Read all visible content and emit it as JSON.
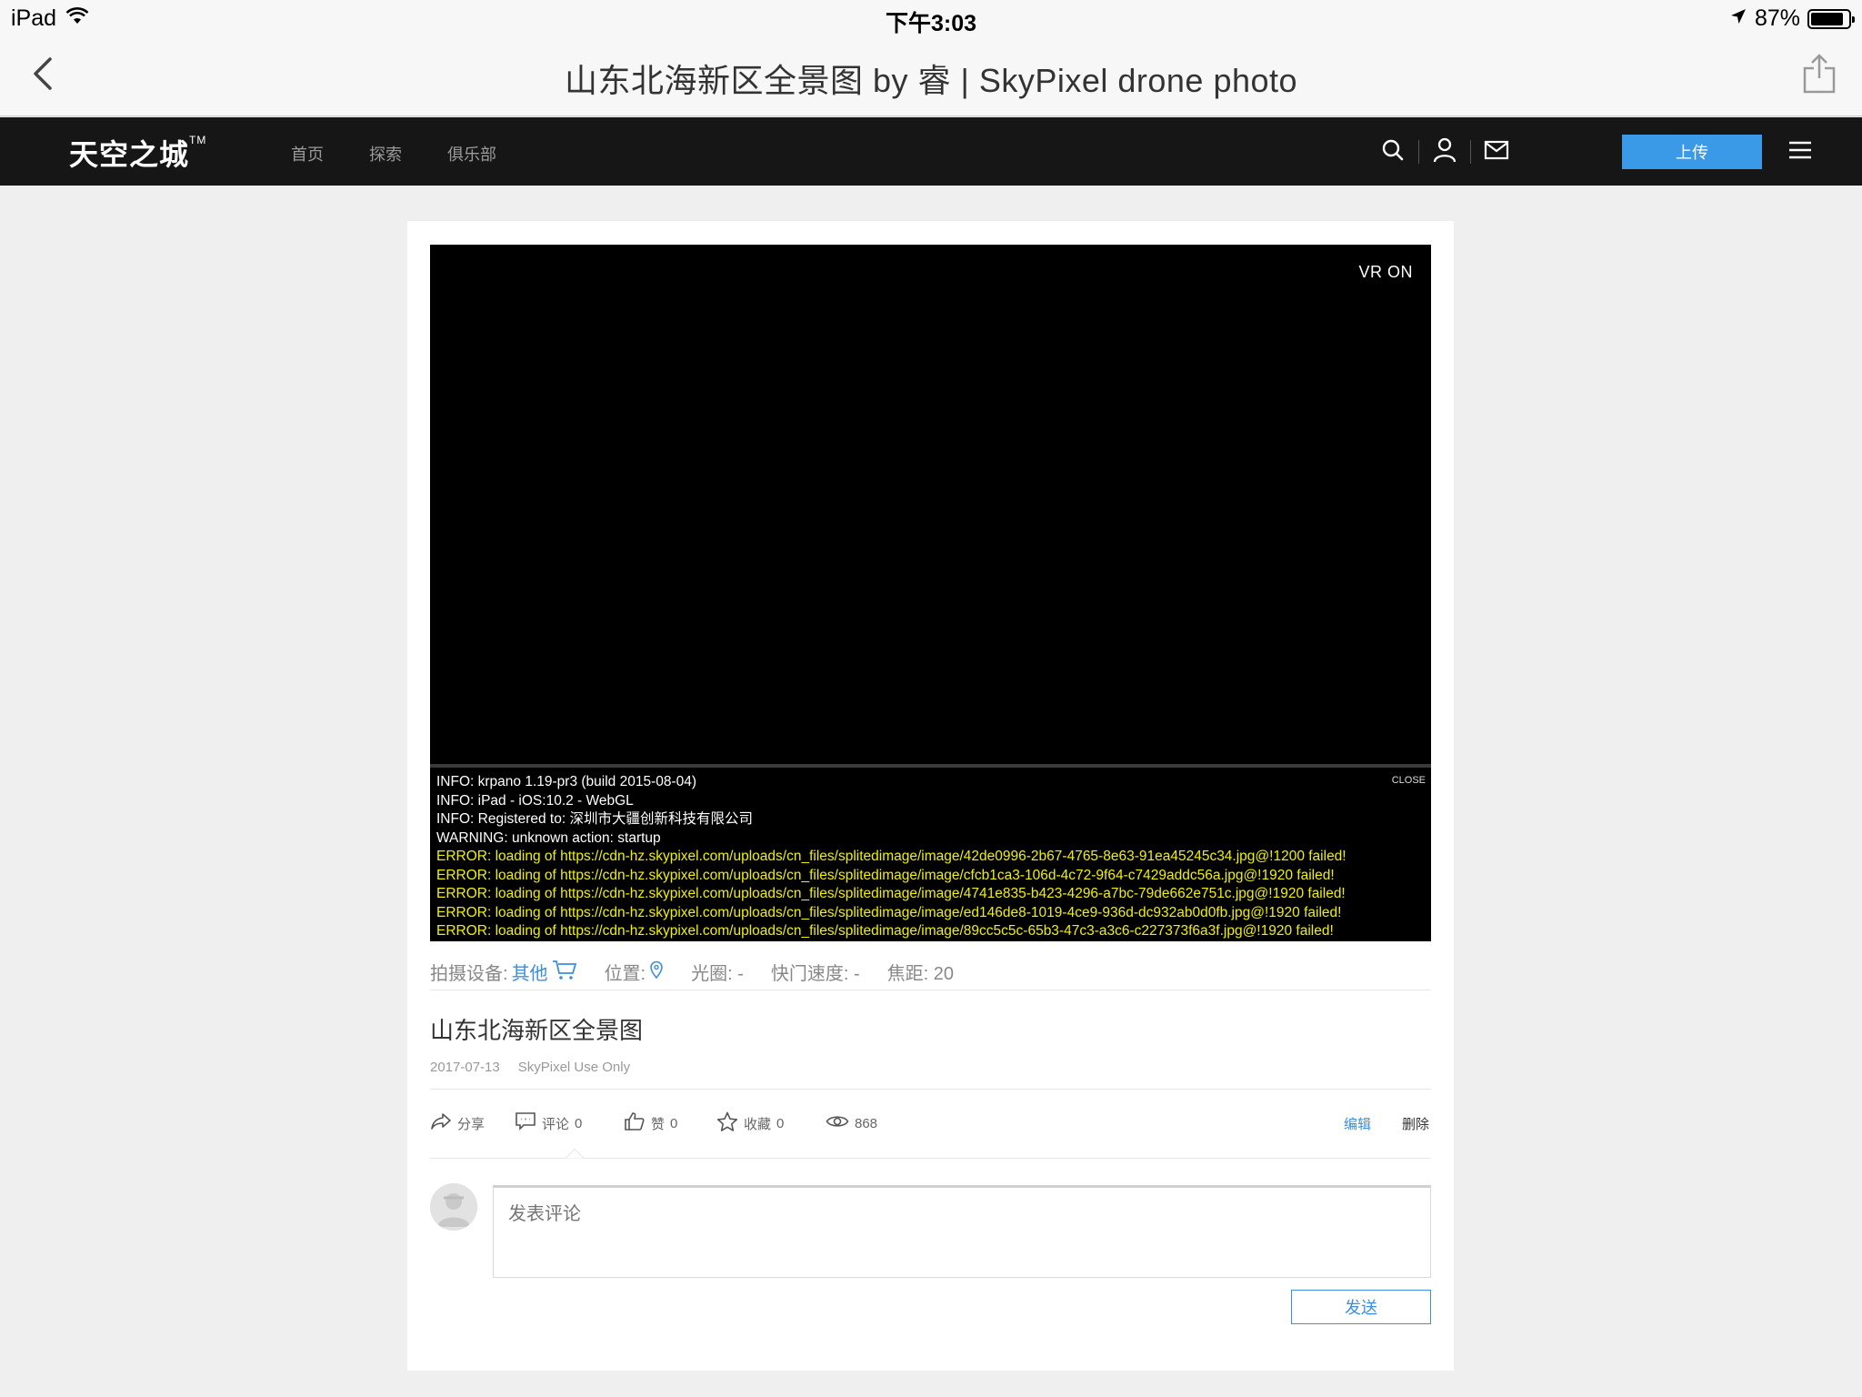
{
  "status_bar": {
    "device": "iPad",
    "time": "下午3:03",
    "battery_text": "87%",
    "battery_level": 0.87
  },
  "browser": {
    "page_title": "山东北海新区全景图 by 睿 | SkyPixel drone photo"
  },
  "site": {
    "logo": "天空之城",
    "logo_tm": "TM",
    "nav": [
      "首页",
      "探索",
      "俱乐部"
    ],
    "upload_label": "上传"
  },
  "viewer": {
    "vr_label": "VR ON",
    "console_close": "CLOSE",
    "log": [
      {
        "level": "info",
        "text": "INFO: krpano 1.19-pr3 (build 2015-08-04)"
      },
      {
        "level": "info",
        "text": "INFO: iPad - iOS:10.2 - WebGL"
      },
      {
        "level": "info",
        "text": "INFO: Registered to: 深圳市大疆创新科技有限公司"
      },
      {
        "level": "info",
        "text": "WARNING: unknown action: startup"
      },
      {
        "level": "error",
        "text": "ERROR: loading of https://cdn-hz.skypixel.com/uploads/cn_files/splitedimage/image/42de0996-2b67-4765-8e63-91ea45245c34.jpg@!1200 failed!"
      },
      {
        "level": "error",
        "text": "ERROR: loading of https://cdn-hz.skypixel.com/uploads/cn_files/splitedimage/image/cfcb1ca3-106d-4c72-9f64-c7429addc56a.jpg@!1920 failed!"
      },
      {
        "level": "error",
        "text": "ERROR: loading of https://cdn-hz.skypixel.com/uploads/cn_files/splitedimage/image/4741e835-b423-4296-a7bc-79de662e751c.jpg@!1920 failed!"
      },
      {
        "level": "error",
        "text": "ERROR: loading of https://cdn-hz.skypixel.com/uploads/cn_files/splitedimage/image/ed146de8-1019-4ce9-936d-dc932ab0d0fb.jpg@!1920 failed!"
      },
      {
        "level": "error",
        "text": "ERROR: loading of https://cdn-hz.skypixel.com/uploads/cn_files/splitedimage/image/89cc5c5c-65b3-47c3-a3c6-c227373f6a3f.jpg@!1920 failed!"
      }
    ]
  },
  "photo_meta": {
    "device_label": "拍摄设备:",
    "device_value": "其他",
    "location_label": "位置:",
    "aperture": "光圈: -",
    "shutter": "快门速度: -",
    "focal": "焦距: 20"
  },
  "post": {
    "title": "山东北海新区全景图",
    "date": "2017-07-13",
    "license": "SkyPixel Use Only"
  },
  "actions": {
    "share": "分享",
    "comment_label": "评论",
    "comment_count": "0",
    "like_label": "赞",
    "like_count": "0",
    "fav_label": "收藏",
    "fav_count": "0",
    "views": "868",
    "edit": "编辑",
    "delete": "删除"
  },
  "comment": {
    "placeholder": "发表评论",
    "send": "发送"
  },
  "colors": {
    "accent": "#3b9ae8",
    "header_bg": "#161616",
    "error_text": "#f0f000"
  }
}
